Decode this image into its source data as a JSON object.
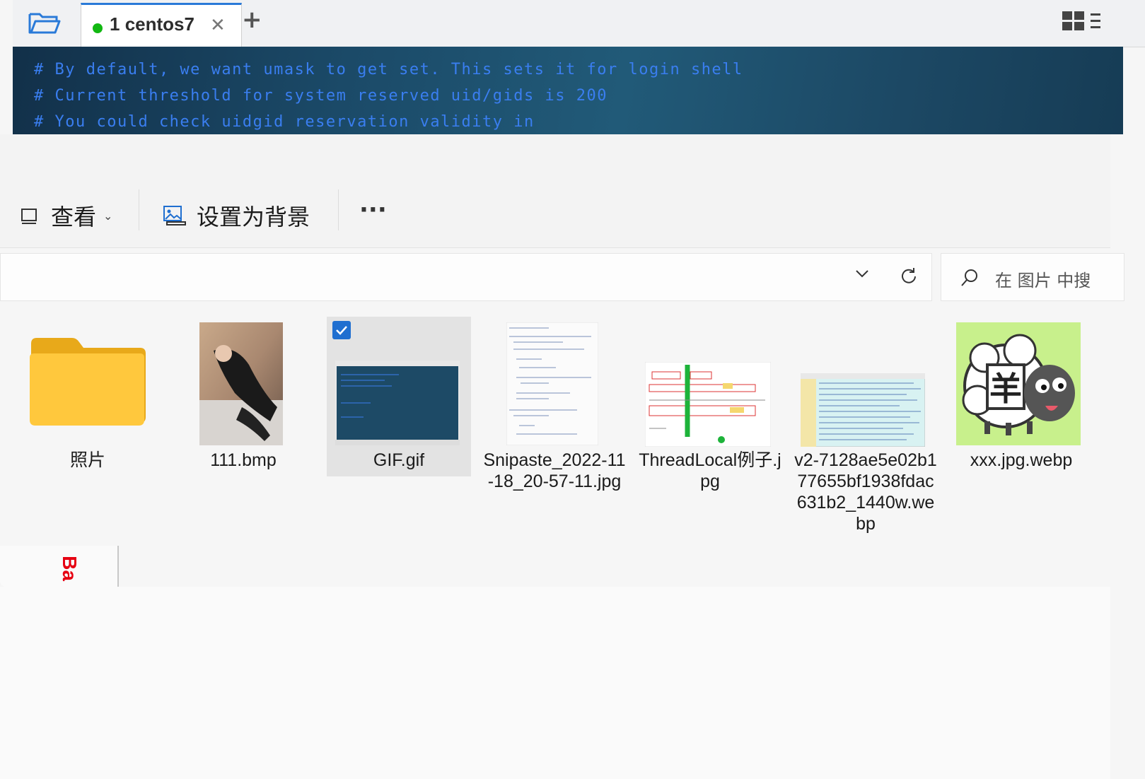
{
  "terminal": {
    "tab_number": "1",
    "tab_name": "centos7",
    "status_color": "#12b812",
    "lines": [
      "# By default, we want umask to get set. This sets it for login shell",
      "# Current threshold for system reserved uid/gids is 200",
      "# You could check uidgid reservation validity in"
    ]
  },
  "commandbar": {
    "view_label": "查看",
    "set_background_label": "设置为背景",
    "more_label": "···"
  },
  "search": {
    "placeholder": "在 图片 中搜"
  },
  "files": [
    {
      "name": "照片",
      "type": "folder"
    },
    {
      "name": "111.bmp",
      "type": "image"
    },
    {
      "name": "GIF.gif",
      "type": "image",
      "selected": true
    },
    {
      "name": "Snipaste_2022-11-18_20-57-11.jpg",
      "type": "image"
    },
    {
      "name": "ThreadLocal例子.jpg",
      "type": "image"
    },
    {
      "name": "v2-7128ae5e02b177655bf1938fdac631b2_1440w.webp",
      "type": "image"
    },
    {
      "name": "xxx.jpg.webp",
      "type": "image"
    }
  ],
  "sheep_label": "羊",
  "baidu_text": "Ba"
}
